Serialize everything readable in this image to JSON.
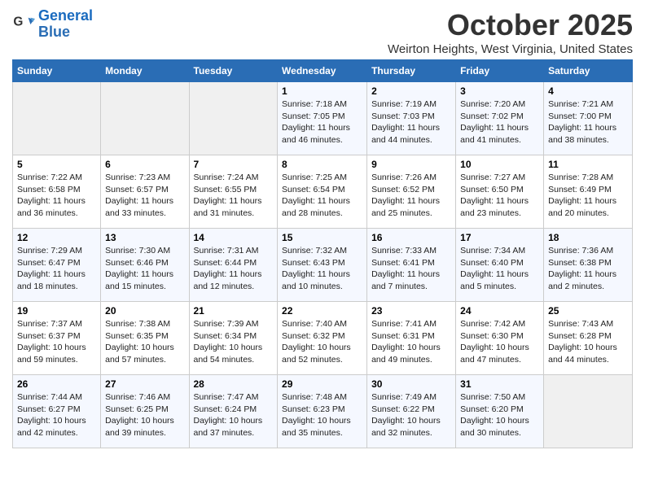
{
  "logo": {
    "line1": "General",
    "line2": "Blue"
  },
  "title": "October 2025",
  "location": "Weirton Heights, West Virginia, United States",
  "days_of_week": [
    "Sunday",
    "Monday",
    "Tuesday",
    "Wednesday",
    "Thursday",
    "Friday",
    "Saturday"
  ],
  "weeks": [
    [
      {
        "day": "",
        "info": ""
      },
      {
        "day": "",
        "info": ""
      },
      {
        "day": "",
        "info": ""
      },
      {
        "day": "1",
        "info": "Sunrise: 7:18 AM\nSunset: 7:05 PM\nDaylight: 11 hours and 46 minutes."
      },
      {
        "day": "2",
        "info": "Sunrise: 7:19 AM\nSunset: 7:03 PM\nDaylight: 11 hours and 44 minutes."
      },
      {
        "day": "3",
        "info": "Sunrise: 7:20 AM\nSunset: 7:02 PM\nDaylight: 11 hours and 41 minutes."
      },
      {
        "day": "4",
        "info": "Sunrise: 7:21 AM\nSunset: 7:00 PM\nDaylight: 11 hours and 38 minutes."
      }
    ],
    [
      {
        "day": "5",
        "info": "Sunrise: 7:22 AM\nSunset: 6:58 PM\nDaylight: 11 hours and 36 minutes."
      },
      {
        "day": "6",
        "info": "Sunrise: 7:23 AM\nSunset: 6:57 PM\nDaylight: 11 hours and 33 minutes."
      },
      {
        "day": "7",
        "info": "Sunrise: 7:24 AM\nSunset: 6:55 PM\nDaylight: 11 hours and 31 minutes."
      },
      {
        "day": "8",
        "info": "Sunrise: 7:25 AM\nSunset: 6:54 PM\nDaylight: 11 hours and 28 minutes."
      },
      {
        "day": "9",
        "info": "Sunrise: 7:26 AM\nSunset: 6:52 PM\nDaylight: 11 hours and 25 minutes."
      },
      {
        "day": "10",
        "info": "Sunrise: 7:27 AM\nSunset: 6:50 PM\nDaylight: 11 hours and 23 minutes."
      },
      {
        "day": "11",
        "info": "Sunrise: 7:28 AM\nSunset: 6:49 PM\nDaylight: 11 hours and 20 minutes."
      }
    ],
    [
      {
        "day": "12",
        "info": "Sunrise: 7:29 AM\nSunset: 6:47 PM\nDaylight: 11 hours and 18 minutes."
      },
      {
        "day": "13",
        "info": "Sunrise: 7:30 AM\nSunset: 6:46 PM\nDaylight: 11 hours and 15 minutes."
      },
      {
        "day": "14",
        "info": "Sunrise: 7:31 AM\nSunset: 6:44 PM\nDaylight: 11 hours and 12 minutes."
      },
      {
        "day": "15",
        "info": "Sunrise: 7:32 AM\nSunset: 6:43 PM\nDaylight: 11 hours and 10 minutes."
      },
      {
        "day": "16",
        "info": "Sunrise: 7:33 AM\nSunset: 6:41 PM\nDaylight: 11 hours and 7 minutes."
      },
      {
        "day": "17",
        "info": "Sunrise: 7:34 AM\nSunset: 6:40 PM\nDaylight: 11 hours and 5 minutes."
      },
      {
        "day": "18",
        "info": "Sunrise: 7:36 AM\nSunset: 6:38 PM\nDaylight: 11 hours and 2 minutes."
      }
    ],
    [
      {
        "day": "19",
        "info": "Sunrise: 7:37 AM\nSunset: 6:37 PM\nDaylight: 10 hours and 59 minutes."
      },
      {
        "day": "20",
        "info": "Sunrise: 7:38 AM\nSunset: 6:35 PM\nDaylight: 10 hours and 57 minutes."
      },
      {
        "day": "21",
        "info": "Sunrise: 7:39 AM\nSunset: 6:34 PM\nDaylight: 10 hours and 54 minutes."
      },
      {
        "day": "22",
        "info": "Sunrise: 7:40 AM\nSunset: 6:32 PM\nDaylight: 10 hours and 52 minutes."
      },
      {
        "day": "23",
        "info": "Sunrise: 7:41 AM\nSunset: 6:31 PM\nDaylight: 10 hours and 49 minutes."
      },
      {
        "day": "24",
        "info": "Sunrise: 7:42 AM\nSunset: 6:30 PM\nDaylight: 10 hours and 47 minutes."
      },
      {
        "day": "25",
        "info": "Sunrise: 7:43 AM\nSunset: 6:28 PM\nDaylight: 10 hours and 44 minutes."
      }
    ],
    [
      {
        "day": "26",
        "info": "Sunrise: 7:44 AM\nSunset: 6:27 PM\nDaylight: 10 hours and 42 minutes."
      },
      {
        "day": "27",
        "info": "Sunrise: 7:46 AM\nSunset: 6:25 PM\nDaylight: 10 hours and 39 minutes."
      },
      {
        "day": "28",
        "info": "Sunrise: 7:47 AM\nSunset: 6:24 PM\nDaylight: 10 hours and 37 minutes."
      },
      {
        "day": "29",
        "info": "Sunrise: 7:48 AM\nSunset: 6:23 PM\nDaylight: 10 hours and 35 minutes."
      },
      {
        "day": "30",
        "info": "Sunrise: 7:49 AM\nSunset: 6:22 PM\nDaylight: 10 hours and 32 minutes."
      },
      {
        "day": "31",
        "info": "Sunrise: 7:50 AM\nSunset: 6:20 PM\nDaylight: 10 hours and 30 minutes."
      },
      {
        "day": "",
        "info": ""
      }
    ]
  ]
}
